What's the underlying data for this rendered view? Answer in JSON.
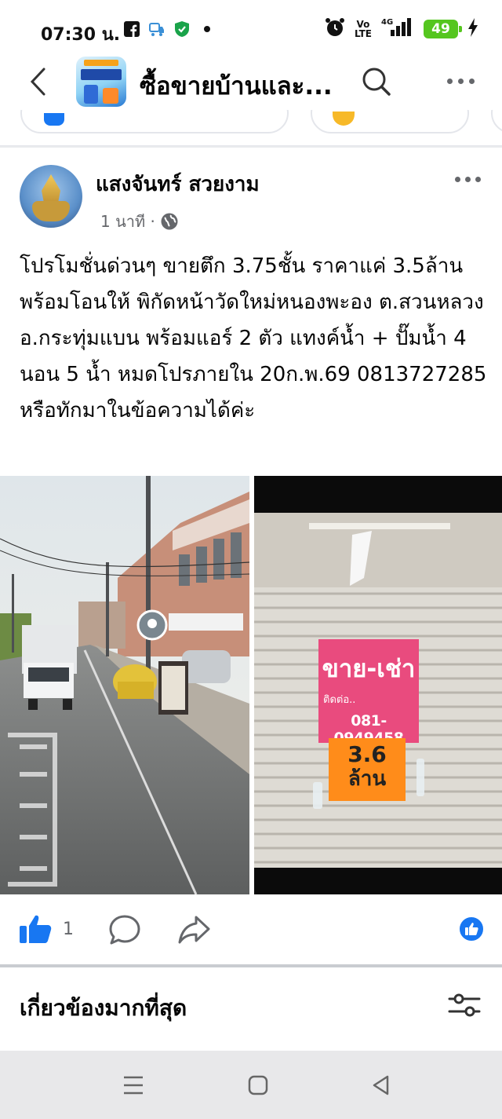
{
  "status_bar": {
    "time": "07:30 น.",
    "volte": "Vo\nLTE",
    "network": "4G",
    "battery": "49"
  },
  "header": {
    "title": "ซื้อขายบ้านและ...",
    "back_icon": "chevron-left-icon",
    "search_icon": "search-icon",
    "more_icon": "more-horizontal-icon"
  },
  "post": {
    "author": "แสงจันทร์ สวยงาม",
    "time_ago": "1 นาที ·",
    "privacy_icon": "globe-icon",
    "text": "โปรโมชั่นด่วนๆ ขายตึก 3.75ชั้น ราคาแค่ 3.5ล้าน พร้อมโอนให้ พิกัดหน้าวัดใหม่หนองพะอง ต.สวนหลวง อ.กระทุ่มแบน พร้อมแอร์ 2 ตัว แทงค์น้ำ + ปั๊มน้ำ  4 นอน 5 น้ำ หมดโปรภายใน 20ก.พ.69 0813727285 หรือทักมาในข้อความได้ค่ะ",
    "sign": {
      "title": "ขาย-เช่า",
      "contact": "ติดต่อ..",
      "phone": "081-0949458",
      "price_line1": "3.6",
      "price_line2": "ล้าน"
    },
    "like_count": "1"
  },
  "related": {
    "title": "เกี่ยวข้องมากที่สุด"
  },
  "colors": {
    "brand_blue": "#1877f2",
    "battery_green": "#55c61f",
    "sign_pink": "#e94b7e",
    "sign_orange": "#ff8c1a"
  }
}
